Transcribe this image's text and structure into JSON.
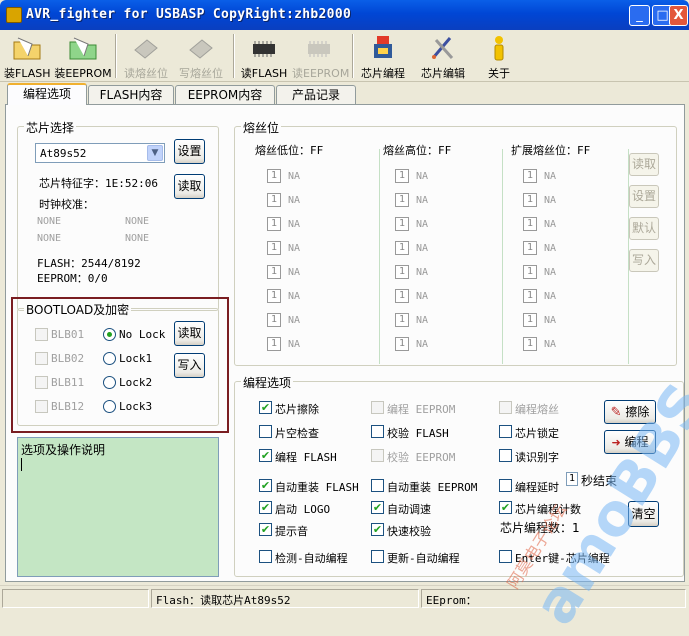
{
  "window": {
    "title": "AVR_fighter for USBASP CopyRight:zhb2000",
    "minimize": "_",
    "maximize": "□",
    "close": "X"
  },
  "toolbar": {
    "load_flash": "装FLASH",
    "load_eeprom": "装EEPROM",
    "read_fuse": "读熔丝位",
    "write_fuse": "写熔丝位",
    "read_flash": "读FLASH",
    "read_eeprom": "读EEPROM",
    "chip_program": "芯片编程",
    "chip_edit": "芯片编辑",
    "about": "关于"
  },
  "tabs": [
    "编程选项",
    "FLASH内容",
    "EEPROM内容",
    "产品记录"
  ],
  "chip": {
    "group_title": "芯片选择",
    "selected": "At89s52",
    "setup_button": "设置",
    "read_button": "读取",
    "signature": "芯片特征字：1E:52:06",
    "clock_label": "时钟校准：",
    "clock_values": [
      "NONE",
      "NONE",
      "NONE",
      "NONE"
    ],
    "flash": "FLASH：2544/8192",
    "eeprom": "EEPROM：0/0"
  },
  "boot": {
    "group_title": "BOOTLOAD及加密",
    "checks": [
      "BLB01",
      "BLB02",
      "BLB11",
      "BLB12"
    ],
    "radios": [
      "No Lock",
      "Lock1",
      "Lock2",
      "Lock3"
    ],
    "selected_radio": "No Lock",
    "read_button": "读取",
    "write_button": "写入"
  },
  "info": {
    "title": "选项及操作说明"
  },
  "fuse": {
    "group_title": "熔丝位",
    "low": "熔丝低位：FF",
    "high": "熔丝高位：FF",
    "ext": "扩展熔丝位：FF",
    "bit_value": "1",
    "na": "NA",
    "buttons": [
      "读取",
      "设置",
      "默认",
      "写入"
    ]
  },
  "prog": {
    "group_title": "编程选项",
    "options": [
      {
        "label": "芯片擦除",
        "checked": true,
        "enabled": true
      },
      {
        "label": "编程 EEPROM",
        "checked": false,
        "enabled": false
      },
      {
        "label": "编程熔丝",
        "checked": false,
        "enabled": false
      },
      {
        "label": "片空检查",
        "checked": false,
        "enabled": true
      },
      {
        "label": "校验 FLASH",
        "checked": false,
        "enabled": true
      },
      {
        "label": "芯片锁定",
        "checked": false,
        "enabled": true
      },
      {
        "label": "编程 FLASH",
        "checked": true,
        "enabled": true
      },
      {
        "label": "校验 EEPROM",
        "checked": false,
        "enabled": false
      },
      {
        "label": "读识别字",
        "checked": false,
        "enabled": true
      },
      {
        "label": "自动重装 FLASH",
        "checked": true,
        "enabled": true
      },
      {
        "label": "自动重装 EEPROM",
        "checked": false,
        "enabled": true
      },
      {
        "label": "编程延时",
        "checked": false,
        "enabled": true
      },
      {
        "label": "启动 LOGO",
        "checked": true,
        "enabled": true
      },
      {
        "label": "自动调速",
        "checked": true,
        "enabled": true
      },
      {
        "label": "芯片编程计数",
        "checked": true,
        "enabled": true
      },
      {
        "label": "提示音",
        "checked": true,
        "enabled": true
      },
      {
        "label": "快速校验",
        "checked": true,
        "enabled": true
      },
      {
        "label": "检测-自动编程",
        "checked": false,
        "enabled": true
      },
      {
        "label": "更新-自动编程",
        "checked": false,
        "enabled": true
      },
      {
        "label": "Enter键-芯片编程",
        "checked": false,
        "enabled": true
      }
    ],
    "delay_value": "1",
    "delay_unit": "秒结束",
    "count_label": "芯片编程数：1",
    "erase_button": "擦除",
    "program_button": "编程",
    "clear_button": "清空"
  },
  "status": {
    "flash": "Flash：读取芯片At89s52",
    "eeprom": "EEprom："
  },
  "watermark": {
    "text": "amoBBS",
    "sub": "阿莫电子论坛"
  }
}
